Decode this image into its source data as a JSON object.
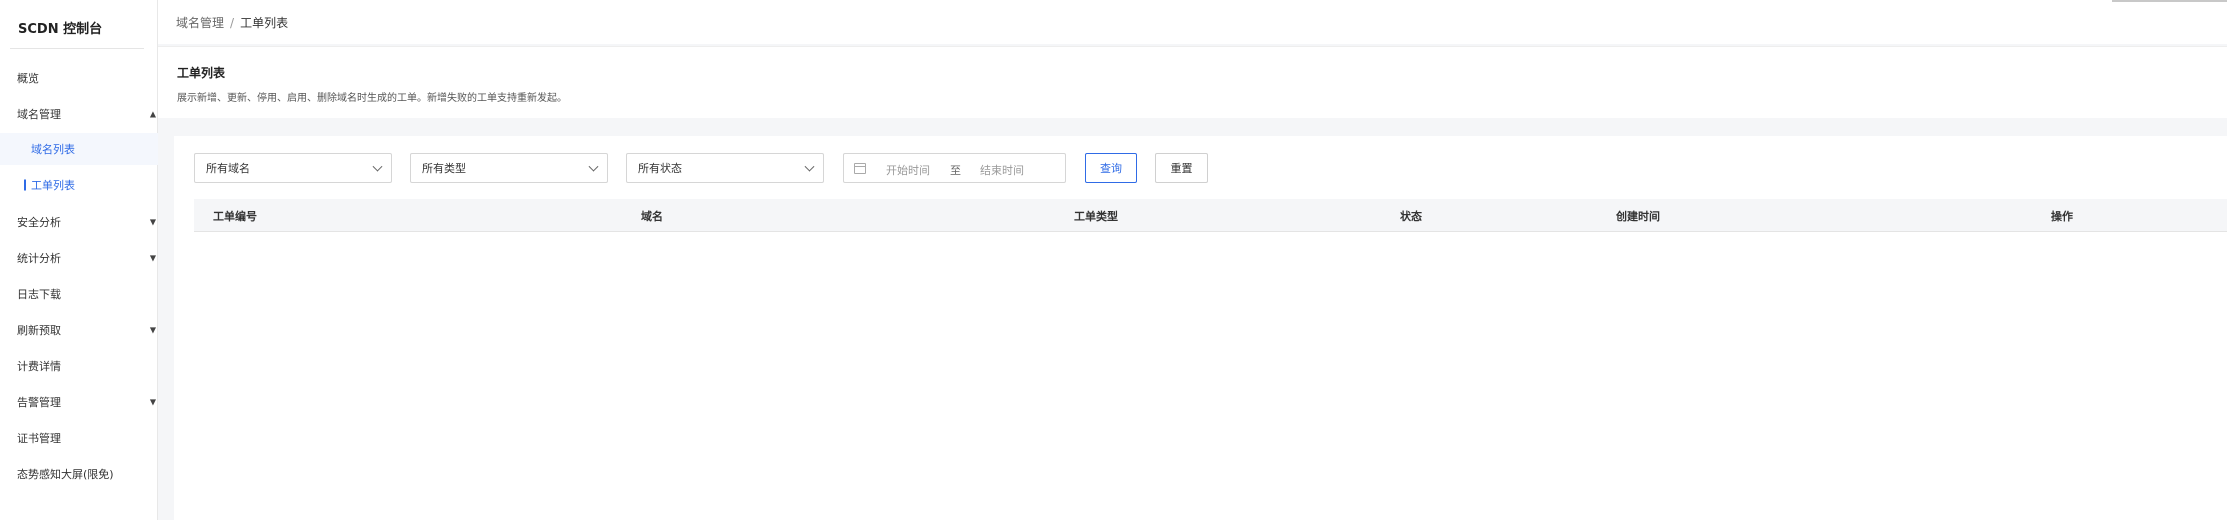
{
  "app": {
    "title": "SCDN 控制台"
  },
  "sidebar": {
    "items": [
      {
        "label": "概览"
      },
      {
        "label": "域名管理",
        "caret": "▲"
      },
      {
        "label": "域名列表"
      },
      {
        "label": "工单列表"
      },
      {
        "label": "安全分析",
        "caret": "▼"
      },
      {
        "label": "统计分析",
        "caret": "▼"
      },
      {
        "label": "日志下载"
      },
      {
        "label": "刷新预取",
        "caret": "▼"
      },
      {
        "label": "计费详情"
      },
      {
        "label": "告警管理",
        "caret": "▼"
      },
      {
        "label": "证书管理"
      },
      {
        "label": "态势感知大屏(限免)"
      }
    ],
    "active_item": "工单列表"
  },
  "breadcrumb": {
    "parent": "域名管理",
    "separator": "/",
    "current": "工单列表"
  },
  "page_header": {
    "title": "工单列表",
    "description": "展示新增、更新、停用、启用、删除域名时生成的工单。新增失败的工单支持重新发起。"
  },
  "filters": {
    "domain_select": "所有域名",
    "type_select": "所有类型",
    "status_select": "所有状态",
    "date_start_placeholder": "开始时间",
    "date_separator": "至",
    "date_end_placeholder": "结束时间",
    "query_button": "查询",
    "reset_button": "重置"
  },
  "table": {
    "columns": [
      "工单编号",
      "域名",
      "工单类型",
      "状态",
      "创建时间",
      "操作"
    ],
    "rows": []
  },
  "colors": {
    "accent": "#2f6be6",
    "background": "#f5f6f8"
  }
}
